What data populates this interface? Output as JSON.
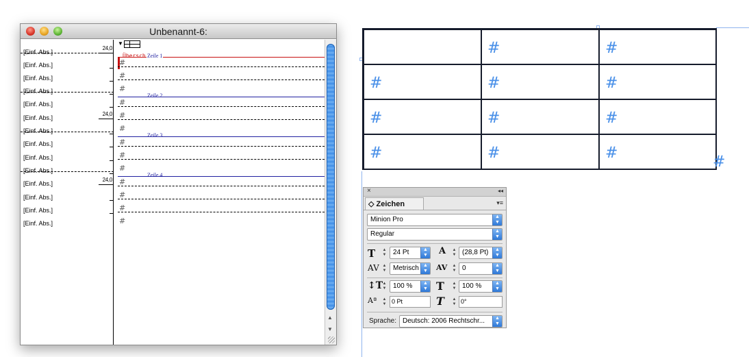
{
  "window": {
    "title": "Unbenannt-6:"
  },
  "gutter": {
    "style_label": "[Einf. Abs.]",
    "size_label": "24,0",
    "rows": 14
  },
  "editor": {
    "ueber_label": "Überschr.",
    "rows": [
      {
        "label": "Zeile 1"
      },
      {
        "label": "Zeile 2"
      },
      {
        "label": "Zeile 3"
      },
      {
        "label": "Zeile 4"
      }
    ],
    "hash": "#"
  },
  "table": {
    "rows": 4,
    "cols": 3,
    "cell_content": "#",
    "overset_mark": "#"
  },
  "panel": {
    "close_icon": "×",
    "collapse_icon": "◂◂",
    "tab_label": "Zeichen",
    "menu_icon": "▾≡",
    "font_family": "Minion Pro",
    "font_style": "Regular",
    "size": "24 Pt",
    "leading": "(28,8 Pt)",
    "kerning": "Metrisch",
    "tracking": "0",
    "vertical_scale": "100 %",
    "horizontal_scale": "100 %",
    "baseline_shift": "0 Pt",
    "skew": "0°",
    "language_label": "Sprache:",
    "language_value": "Deutsch: 2006 Rechtschr..."
  }
}
